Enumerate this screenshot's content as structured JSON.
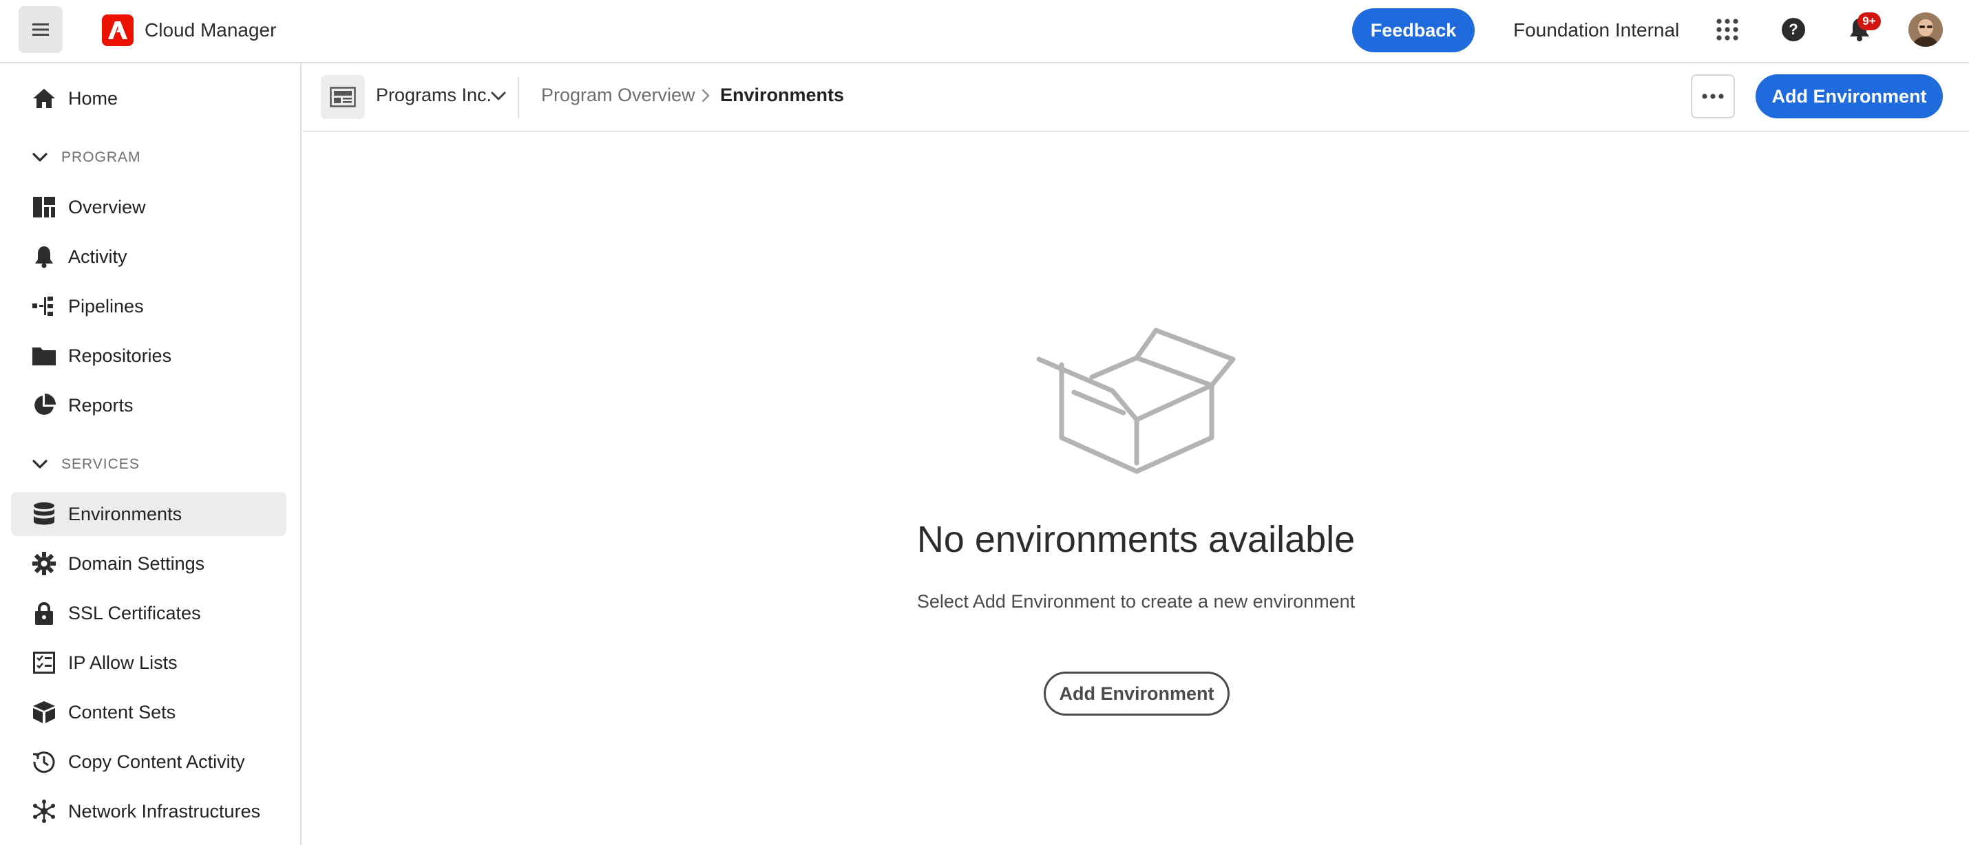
{
  "topbar": {
    "menu_icon": "hamburger-icon",
    "logo_icon": "adobe-logo-icon",
    "app_title": "Cloud Manager",
    "feedback_label": "Feedback",
    "org_name": "Foundation Internal",
    "apps_icon": "app-grid-icon",
    "help_icon": "help-icon",
    "notifications_icon": "bell-icon",
    "notifications_badge": "9+",
    "avatar_icon": "user-avatar-icon",
    "accent_color": "#1f6bde",
    "logo_color": "#eb1000",
    "badge_color": "#d31510"
  },
  "sidebar": {
    "home": {
      "label": "Home",
      "icon": "home-icon"
    },
    "sections": {
      "program": {
        "label": "PROGRAM",
        "icon": "chevron-down-icon"
      },
      "services": {
        "label": "SERVICES",
        "icon": "chevron-down-icon"
      }
    },
    "program_items": [
      {
        "label": "Overview",
        "icon": "dashboard-icon"
      },
      {
        "label": "Activity",
        "icon": "bell-icon"
      },
      {
        "label": "Pipelines",
        "icon": "pipeline-icon"
      },
      {
        "label": "Repositories",
        "icon": "folder-icon"
      },
      {
        "label": "Reports",
        "icon": "pie-chart-icon"
      }
    ],
    "services_items": [
      {
        "label": "Environments",
        "icon": "database-icon",
        "selected": true
      },
      {
        "label": "Domain Settings",
        "icon": "gear-icon"
      },
      {
        "label": "SSL Certificates",
        "icon": "lock-icon"
      },
      {
        "label": "IP Allow Lists",
        "icon": "checklist-icon"
      },
      {
        "label": "Content Sets",
        "icon": "boxes-icon"
      },
      {
        "label": "Copy Content Activity",
        "icon": "history-icon"
      },
      {
        "label": "Network Infrastructures",
        "icon": "network-icon"
      }
    ]
  },
  "header": {
    "program_icon": "program-card-icon",
    "program_name": "Programs Inc.",
    "program_chevron": "chevron-down-icon",
    "breadcrumb": [
      "Program Overview",
      "Environments"
    ],
    "breadcrumb_separator_icon": "chevron-right-icon",
    "more_icon": "more-icon",
    "add_environment_label": "Add Environment"
  },
  "empty_state": {
    "illustration": "open-box-illustration",
    "title": "No environments available",
    "description": "Select Add Environment to create a new environment",
    "button_label": "Add Environment"
  }
}
